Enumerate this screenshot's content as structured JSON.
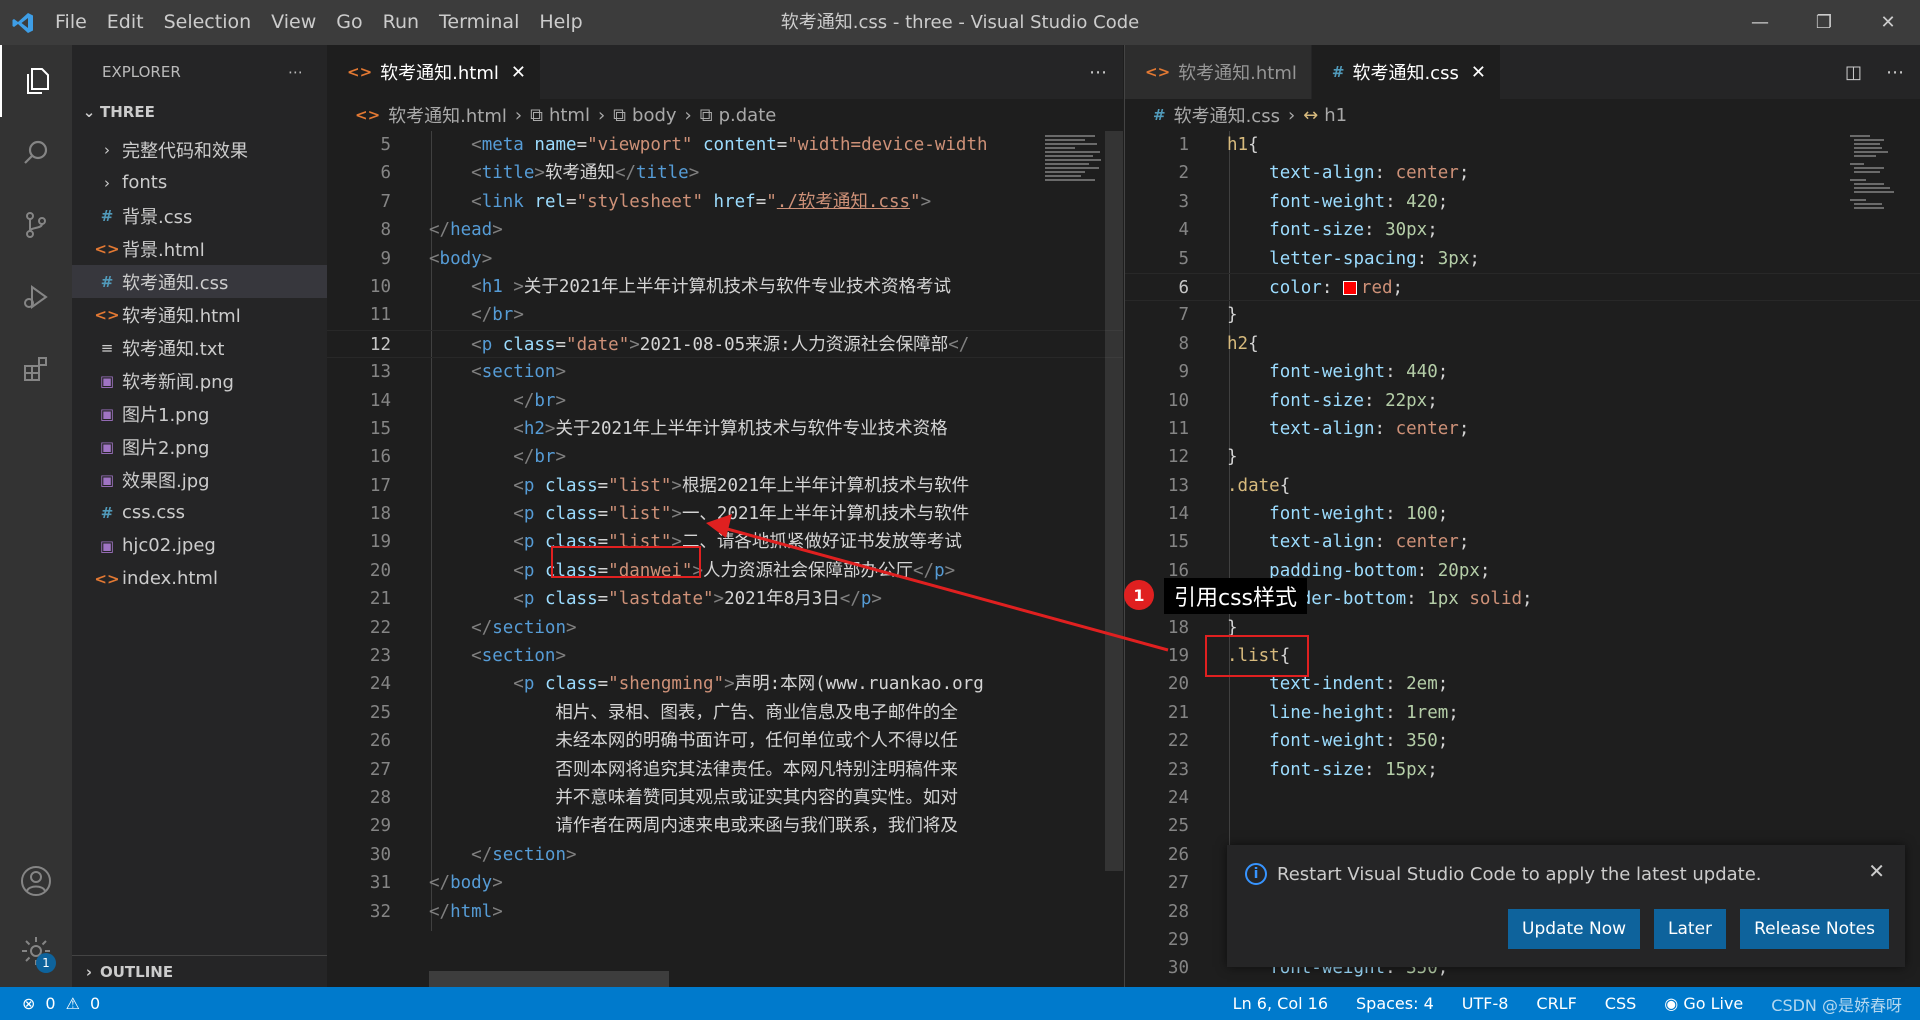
{
  "window": {
    "title": "软考通知.css - three - Visual Studio Code",
    "menu": [
      "File",
      "Edit",
      "Selection",
      "View",
      "Go",
      "Run",
      "Terminal",
      "Help"
    ]
  },
  "sidebar": {
    "header": "EXPLORER",
    "section": "THREE",
    "items": [
      {
        "label": "完整代码和效果",
        "icon": "folder-chevron-icon"
      },
      {
        "label": "fonts",
        "icon": "folder-chevron-icon"
      },
      {
        "label": "背景.css",
        "icon": "css-file-icon"
      },
      {
        "label": "背景.html",
        "icon": "html-file-icon"
      },
      {
        "label": "软考通知.css",
        "icon": "css-file-icon"
      },
      {
        "label": "软考通知.html",
        "icon": "html-file-icon"
      },
      {
        "label": "软考通知.txt",
        "icon": "text-file-icon"
      },
      {
        "label": "软考新闻.png",
        "icon": "image-file-icon"
      },
      {
        "label": "图片1.png",
        "icon": "image-file-icon"
      },
      {
        "label": "图片2.png",
        "icon": "image-file-icon"
      },
      {
        "label": "效果图.jpg",
        "icon": "image-file-icon"
      },
      {
        "label": "css.css",
        "icon": "css-file-icon"
      },
      {
        "label": "hjc02.jpeg",
        "icon": "image-file-icon"
      },
      {
        "label": "index.html",
        "icon": "html-file-icon"
      }
    ],
    "outline": "OUTLINE"
  },
  "left_editor": {
    "tab": "软考通知.html",
    "breadcrumb": [
      "软考通知.html",
      "html",
      "body",
      "p.date"
    ]
  },
  "right_editor": {
    "tabs": [
      "软考通知.html",
      "软考通知.css"
    ],
    "breadcrumb": [
      "软考通知.css",
      "h1"
    ]
  },
  "annotation": {
    "number": "1",
    "label": "引用css样式"
  },
  "notification": {
    "message": "Restart Visual Studio Code to apply the latest update.",
    "buttons": [
      "Update Now",
      "Later",
      "Release Notes"
    ]
  },
  "statusbar": {
    "errors": "0",
    "warnings": "0",
    "position": "Ln 6, Col 16",
    "spaces": "Spaces: 4",
    "encoding": "UTF-8",
    "eol": "CRLF",
    "language": "CSS",
    "golive": "Go Live",
    "watermark": "CSDN @是娇春呀",
    "badge": "1"
  },
  "colors": {
    "statusbar": "#007acc",
    "annotation": "#e02020",
    "button": "#0e639c"
  }
}
